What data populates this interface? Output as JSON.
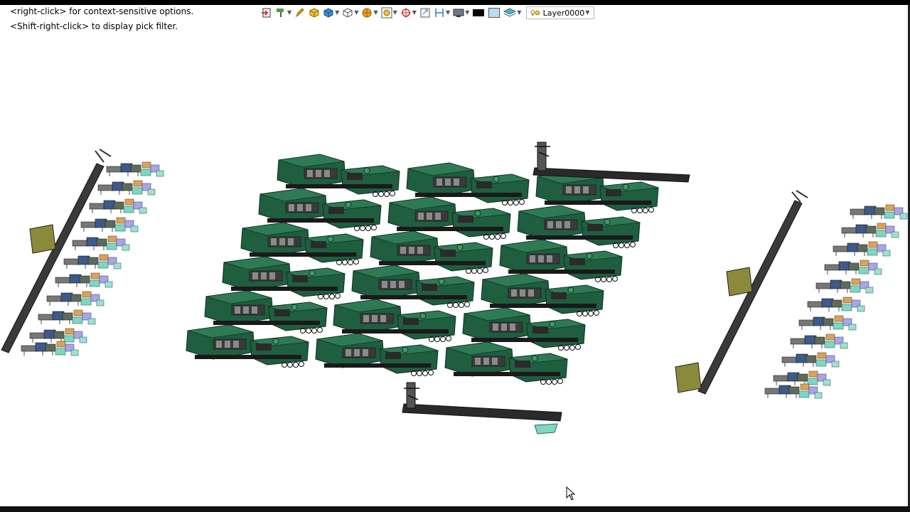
{
  "hints": {
    "line1": "<right-click> for context-sensitive options.",
    "line2": "<Shift-right-click> to display pick filter."
  },
  "toolbar": {
    "layer_label": "Layer0000",
    "icons": [
      "exit-sketch-icon",
      "paint-roller-icon",
      "pencil-icon",
      "solid-box-icon",
      "shaded-box-icon",
      "wire-box-icon",
      "render-ball-icon",
      "fit-view-icon",
      "orient-icon",
      "window-icon",
      "section-icon",
      "display-mode-icon",
      "color-swatch-black-icon",
      "color-swatch-light-icon",
      "layer-icon"
    ]
  },
  "colors": {
    "machine_body": "#1f5e3f",
    "machine_dark": "#0f2f22",
    "rail": "#2a2a2a",
    "accent_teal": "#7fd6c2",
    "accent_tan": "#d9a35c",
    "accent_lavender": "#a9a6e6"
  }
}
